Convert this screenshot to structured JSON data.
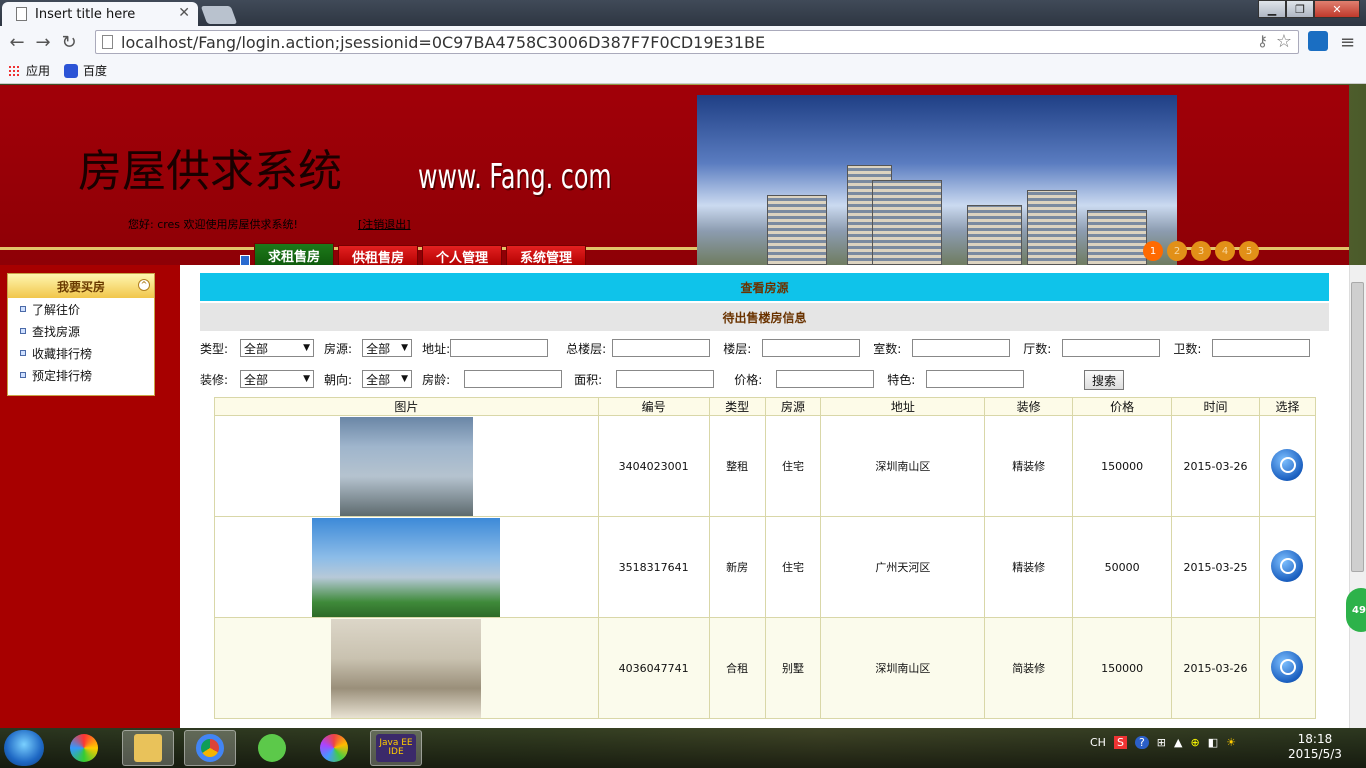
{
  "browser": {
    "tab_title": "Insert title here",
    "url": "localhost/Fang/login.action;jsessionid=0C97BA4758C3006D387F7F0CD19E31BE",
    "bookmarks": [
      "应用",
      "百度"
    ]
  },
  "header": {
    "title": "房屋供求系统",
    "site_url": "www. Fang. com",
    "greeting": "您好: cres 欢迎使用房屋供求系统!",
    "logout": "[注销退出]",
    "menu": [
      "求租售房",
      "供租售房",
      "个人管理",
      "系统管理"
    ],
    "slides": [
      "1",
      "2",
      "3",
      "4",
      "5"
    ]
  },
  "sidebar": {
    "title": "我要买房",
    "items": [
      "了解往价",
      "查找房源",
      "收藏排行榜",
      "预定排行榜"
    ]
  },
  "content": {
    "bar_title": "查看房源",
    "section_title": "待出售楼房信息",
    "filters": {
      "type_label": "类型:",
      "type_value": "全部",
      "source_label": "房源:",
      "source_value": "全部",
      "address_label": "地址:",
      "total_floors_label": "总楼层:",
      "floor_label": "楼层:",
      "rooms_label": "室数:",
      "halls_label": "厅数:",
      "baths_label": "卫数:",
      "decor_label": "装修:",
      "decor_value": "全部",
      "orient_label": "朝向:",
      "orient_value": "全部",
      "age_label": "房龄:",
      "area_label": "面积:",
      "price_label": "价格:",
      "feature_label": "特色:",
      "search_btn": "搜索"
    },
    "table": {
      "headers": [
        "图片",
        "编号",
        "类型",
        "房源",
        "地址",
        "装修",
        "价格",
        "时间",
        "选择"
      ],
      "rows": [
        {
          "id": "3404023001",
          "type": "整租",
          "source": "住宅",
          "address": "深圳南山区",
          "decor": "精装修",
          "price": "150000",
          "date": "2015-03-26"
        },
        {
          "id": "3518317641",
          "type": "新房",
          "source": "住宅",
          "address": "广州天河区",
          "decor": "精装修",
          "price": "50000",
          "date": "2015-03-25"
        },
        {
          "id": "4036047741",
          "type": "合租",
          "source": "别墅",
          "address": "深圳南山区",
          "decor": "简装修",
          "price": "150000",
          "date": "2015-03-26"
        }
      ]
    }
  },
  "floatball": "49",
  "taskbar": {
    "lang": "CH",
    "time": "18:18",
    "date": "2015/5/3",
    "java_label": "Java EE IDE"
  }
}
